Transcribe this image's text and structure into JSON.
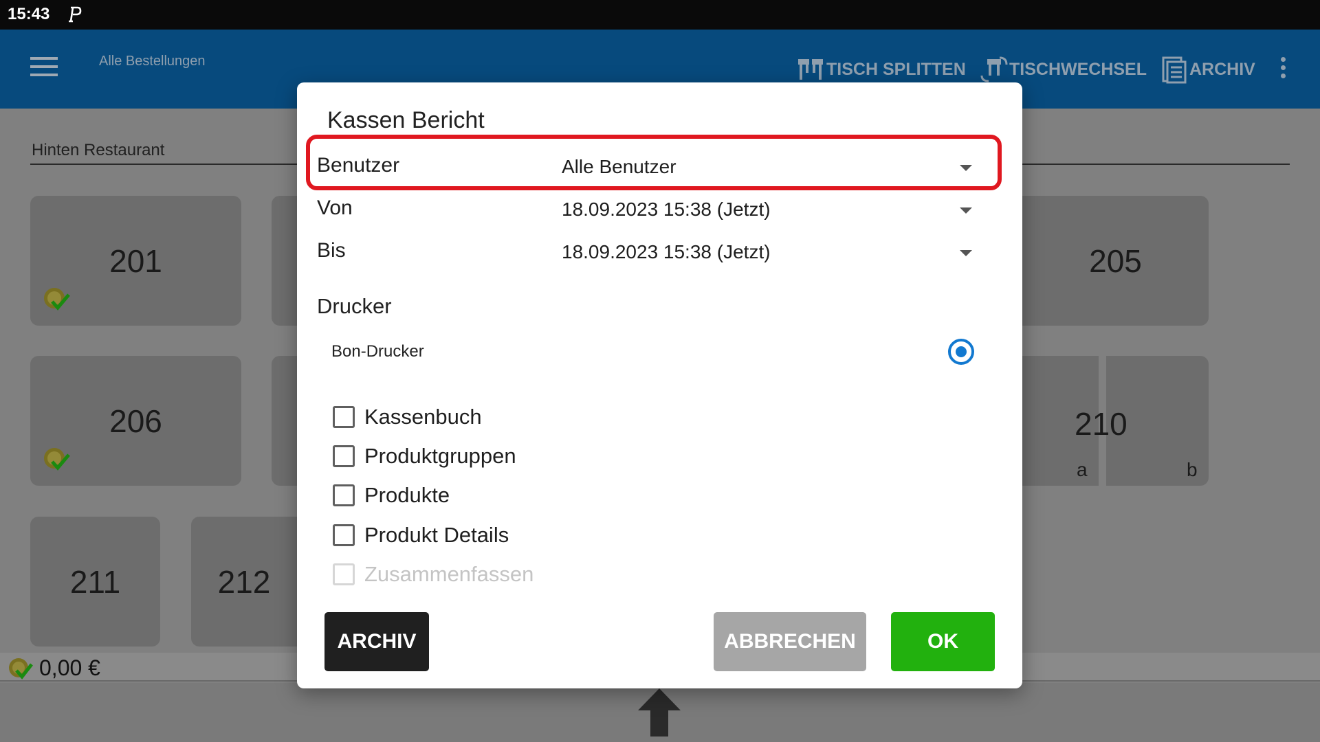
{
  "status_bar": {
    "time": "15:43",
    "icon": "p-notification-icon"
  },
  "app_bar": {
    "title": "Alle Bestellungen",
    "actions": [
      {
        "label": "TISCH SPLITTEN",
        "icon": "split-table-icon"
      },
      {
        "label": "TISCHWECHSEL",
        "icon": "table-change-icon"
      },
      {
        "label": "ARCHIV",
        "icon": "archive-icon"
      }
    ]
  },
  "area": {
    "name": "Hinten Restaurant"
  },
  "tables": {
    "t201": "201",
    "t205": "205",
    "t206": "206",
    "t210": "210",
    "t210a": "a",
    "t210b": "b",
    "t211": "211",
    "t212": "212"
  },
  "bottom": {
    "total": "0,00 €"
  },
  "dialog": {
    "title": "Kassen Bericht",
    "fields": {
      "user": {
        "label": "Benutzer",
        "value": "Alle Benutzer"
      },
      "from": {
        "label": "Von",
        "value": "18.09.2023 15:38 (Jetzt)"
      },
      "to": {
        "label": "Bis",
        "value": "18.09.2023 15:38 (Jetzt)"
      }
    },
    "printer_section": "Drucker",
    "printer": {
      "label": "Bon-Drucker",
      "selected": true
    },
    "checkboxes": [
      {
        "label": "Kassenbuch",
        "checked": false,
        "enabled": true
      },
      {
        "label": "Produktgruppen",
        "checked": false,
        "enabled": true
      },
      {
        "label": "Produkte",
        "checked": false,
        "enabled": true
      },
      {
        "label": "Produkt Details",
        "checked": false,
        "enabled": true
      },
      {
        "label": "Zusammenfassen",
        "checked": false,
        "enabled": false
      }
    ],
    "buttons": {
      "archive": "ARCHIV",
      "cancel": "ABBRECHEN",
      "ok": "OK"
    }
  },
  "colors": {
    "app_bar": "#074a7d",
    "highlight": "#e01820",
    "ok_button": "#22b10e",
    "radio": "#1279d0"
  }
}
